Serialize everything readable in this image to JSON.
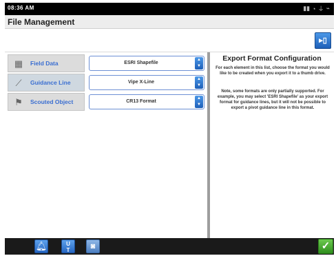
{
  "status_bar": {
    "time": "08:36 AM"
  },
  "window": {
    "title": "File Management"
  },
  "toolbar": {
    "export_icon": "export-to-usb-icon"
  },
  "export_rows": [
    {
      "label": "Field Data",
      "icon": "field-boundary-icon",
      "selected": "ESRI Shapefile"
    },
    {
      "label": "Guidance Line",
      "icon": "guidance-line-icon",
      "selected": "Vipe X-Line"
    },
    {
      "label": "Scouted Object",
      "icon": "scouted-object-icon",
      "selected": "CR13 Format"
    }
  ],
  "info_panel": {
    "title": "Export Format Configuration",
    "paragraph_1": "For each element in this list, choose the format you would like to be created when you export it to a thumb drive.",
    "paragraph_2": "Note, some formats are only partially supported. For example, you may select 'ESRI Shapefile' as your export format for guidance lines, but it will not be possible to export a pivot guidance line in this format."
  },
  "bottom_bar": {
    "icons": [
      "bell-icon",
      "units-icon",
      "camera-icon",
      "checkmark-icon"
    ]
  },
  "colors": {
    "accent_blue": "#2666c2",
    "label_text_blue": "#3a6ed1",
    "confirm_green": "#2f8f1e"
  }
}
